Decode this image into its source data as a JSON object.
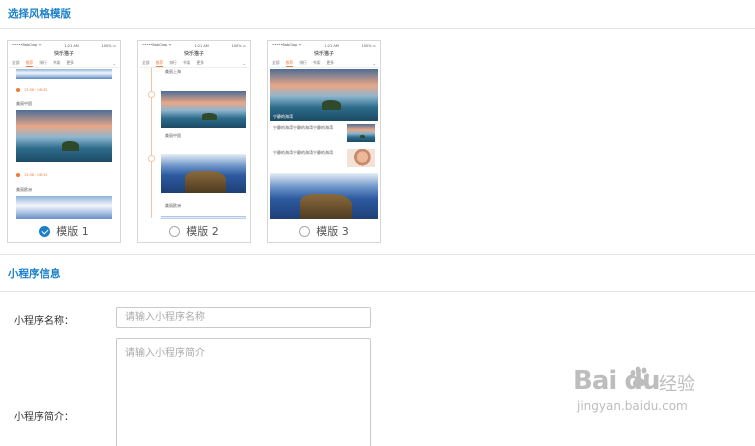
{
  "sections": {
    "style_title": "选择风格模版",
    "info_title": "小程序信息"
  },
  "templates": [
    {
      "label": "模版 1",
      "selected": true,
      "phone": {
        "status_left": "•••••BabCtop ᯤ",
        "status_time": "1:21 AM",
        "status_right": "100% ▭",
        "app_title": "快乐猫子",
        "tabs": [
          "全部",
          "推荐",
          "排行",
          "书架",
          "更多"
        ],
        "active_tab": 1,
        "captions": [
          "美丽中国",
          "美丽欧洲"
        ],
        "timeline_text": "13:58 · 08:32"
      }
    },
    {
      "label": "模版 2",
      "selected": false,
      "phone": {
        "status_left": "•••••BabCtop ᯤ",
        "status_time": "1:21 AM",
        "status_right": "100% ▭",
        "app_title": "快乐猫子",
        "tabs": [
          "全部",
          "推荐",
          "排行",
          "书架",
          "更多"
        ],
        "active_tab": 1,
        "captions": [
          "美丽上海",
          "美丽中国",
          "美丽欧洲"
        ]
      }
    },
    {
      "label": "模版 3",
      "selected": false,
      "phone": {
        "status_left": "•••••BabCtop ᯤ",
        "status_time": "1:21 AM",
        "status_right": "100% ▭",
        "app_title": "快乐猫子",
        "tabs": [
          "全部",
          "推荐",
          "排行",
          "书架",
          "更多"
        ],
        "active_tab": 1,
        "items": [
          "宁静的海湾宁静的海湾宁静的海湾",
          "宁静的海湾宁静的海湾宁静的海湾"
        ],
        "overlay": "宁静的海湾"
      }
    }
  ],
  "form": {
    "name_label": "小程序名称：",
    "name_placeholder": "请输入小程序名称",
    "name_value": "",
    "intro_label": "小程序简介：",
    "intro_placeholder": "请输入小程序简介",
    "intro_value": ""
  },
  "watermark": {
    "logo": "Bai du",
    "cn": "经验",
    "url": "jingyan.baidu.com"
  },
  "colors": {
    "accent": "#1a7fc9",
    "tab_active": "#f07a38"
  }
}
